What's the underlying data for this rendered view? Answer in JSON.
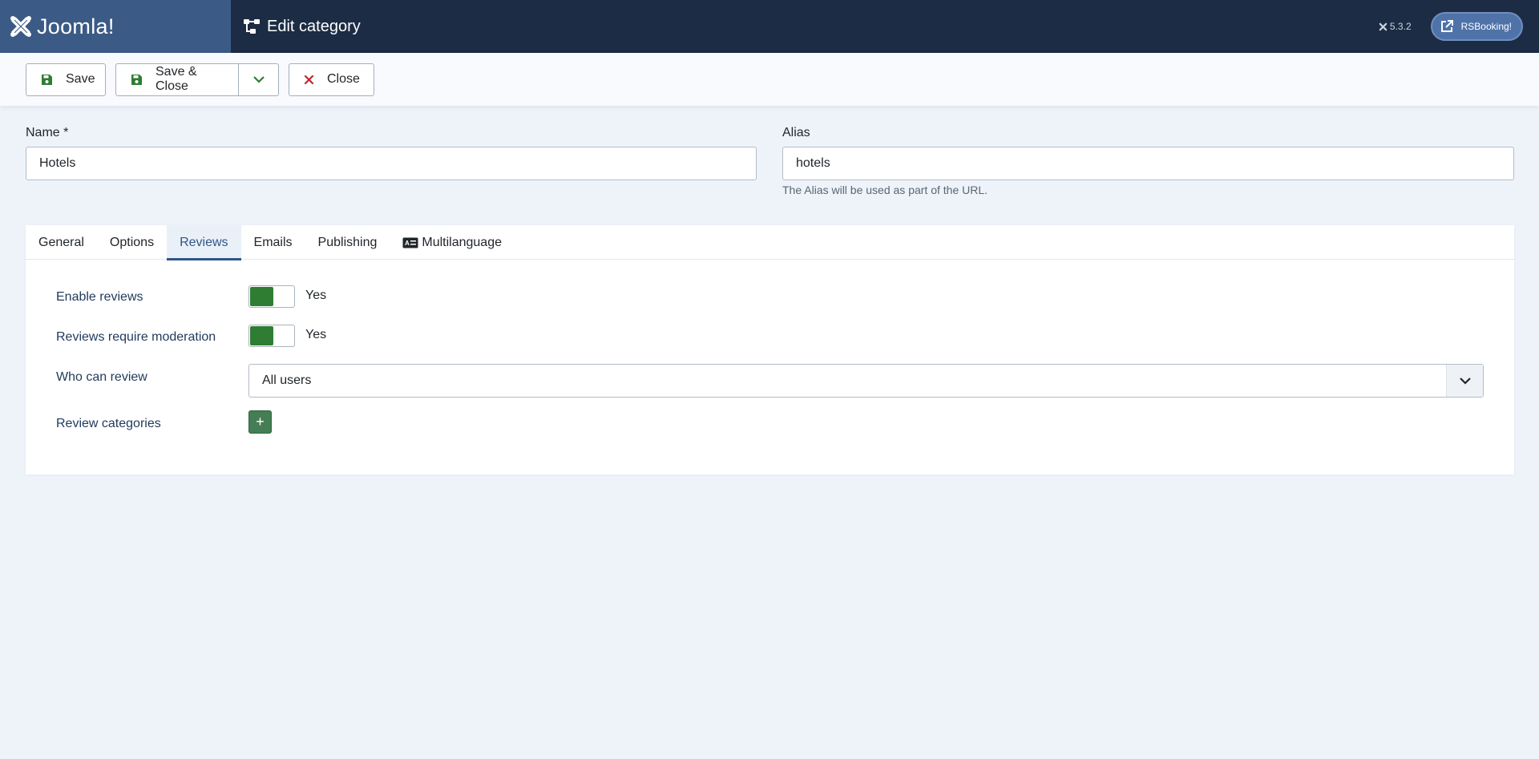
{
  "header": {
    "logo_text": "Joomla!",
    "page_title": "Edit category",
    "version": "5.3.2",
    "site_button_label": "RSBooking!"
  },
  "toolbar": {
    "save_label": "Save",
    "save_close_label": "Save & Close",
    "close_label": "Close"
  },
  "form": {
    "name_label": "Name *",
    "name_value": "Hotels",
    "alias_label": "Alias",
    "alias_value": "hotels",
    "alias_help": "The Alias will be used as part of the URL."
  },
  "tabs": [
    {
      "label": "General"
    },
    {
      "label": "Options"
    },
    {
      "label": "Reviews"
    },
    {
      "label": "Emails"
    },
    {
      "label": "Publishing"
    },
    {
      "label": "Multilanguage"
    }
  ],
  "reviews": {
    "enable_label": "Enable reviews",
    "enable_value": "Yes",
    "moderation_label": "Reviews require moderation",
    "moderation_value": "Yes",
    "who_label": "Who can review",
    "who_value": "All users",
    "categories_label": "Review categories",
    "add_symbol": "+"
  },
  "colors": {
    "header_bg": "#1c2c44",
    "logo_bg": "#3b5a85",
    "switch_on": "#2e7d32",
    "close_icon": "#c0262d",
    "active_tab": "#2f5689"
  }
}
